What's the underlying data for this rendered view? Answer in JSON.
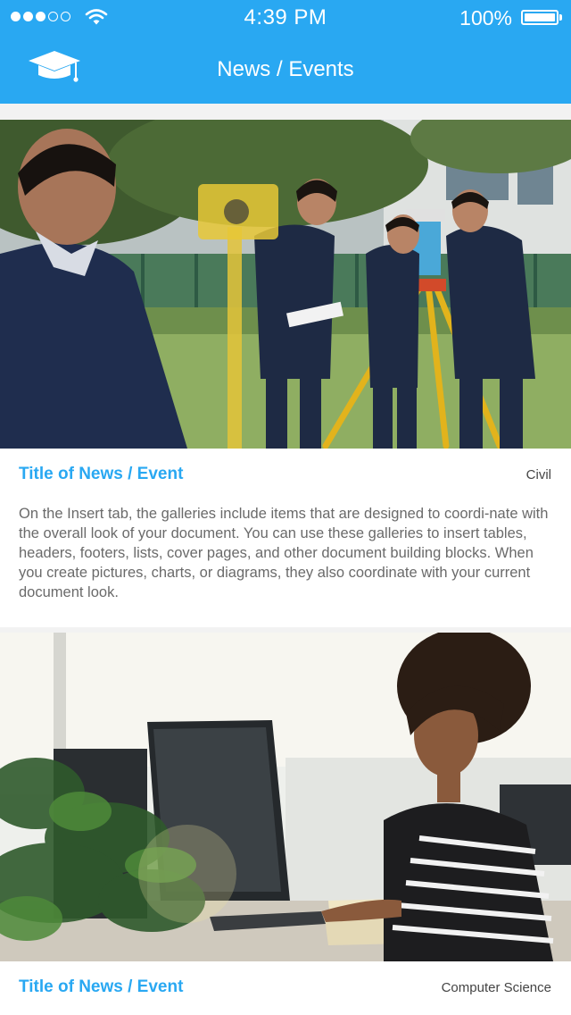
{
  "status_bar": {
    "signal_bars_filled": 3,
    "signal_bars_total": 5,
    "time": "4:39 PM",
    "battery_percent": "100%"
  },
  "nav": {
    "logo_icon": "graduation-cap-icon",
    "title": "News / Events"
  },
  "colors": {
    "primary": "#29a8f2",
    "background": "#f2f2f2",
    "card": "#ffffff",
    "body_text": "#6a6a6a"
  },
  "news": [
    {
      "title": "Title of News / Event",
      "category": "Civil",
      "description": "On the Insert tab, the galleries include items that are designed to coordi-nate with the overall look of your document. You can use these galleries to insert tables, headers, footers, lists, cover pages, and other document building blocks. When you create pictures, charts, or diagrams, they also coordinate with your current document look."
    },
    {
      "title": "Title of News / Event",
      "category": "Computer Science"
    }
  ]
}
